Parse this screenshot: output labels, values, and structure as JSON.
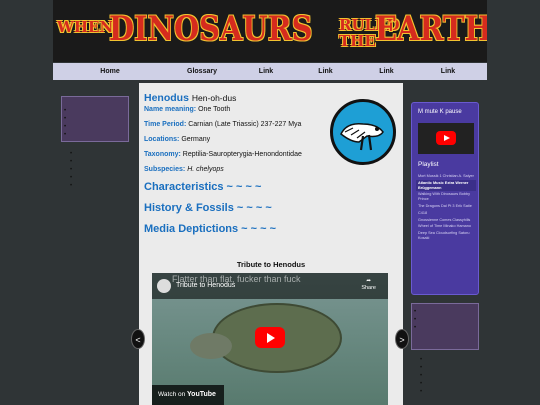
{
  "banner": {
    "when": "WHEN",
    "dinosaurs": "DINOSAURS",
    "ruled": "RULED",
    "the": "THE",
    "earth": "EARTH"
  },
  "nav": [
    "Home",
    "Glossary",
    "Link",
    "Link",
    "Link",
    "Link"
  ],
  "species": {
    "name": "Henodus",
    "pronunciation": "Hen-oh-dus",
    "fields": [
      {
        "label": "Name meaning:",
        "value": "One Tooth"
      },
      {
        "label": "Time Period:",
        "value": "Carnian (Late Triassic) 237-227 Mya"
      },
      {
        "label": "Locations:",
        "value": "Germany"
      },
      {
        "label": "Taxonomy:",
        "value": "Reptilia-Sauropterygia-Henondontidae"
      },
      {
        "label": "Subspecies:",
        "value": "H. chelyops"
      }
    ]
  },
  "sections": [
    "Characteristics ~ ~ ~ ~",
    "History & Fossils ~ ~ ~ ~",
    "Media Deptictions ~ ~ ~ ~"
  ],
  "video": {
    "heading": "Tribute to Henodus",
    "title": "Tribute to Henodus",
    "overlay_text": "Flatter than flat, fucker than fuck",
    "share": "Share",
    "watch_on": "Watch on",
    "youtube": "YouTube"
  },
  "arrows": {
    "prev": "<",
    "next": ">"
  },
  "player": {
    "title": "M mute K pause",
    "playlist_label": "Playlist",
    "items": [
      "Mort Mussik 1 Christian A. Salyer",
      "Atlantic Music Extra Werner Brüggemann",
      "Walking With Dinosaurs Bobby Prince",
      "The Dragons Dal Pt 3 Erik Satie",
      "C418",
      "Gnossienne Comes Classyhills",
      "Wheel of Time Minako Hamano",
      "Deep Sea Cloudsurfing Satoru Kosaki"
    ],
    "active_index": 1
  },
  "colors": {
    "accent": "#1a6fbf",
    "nav_bg": "#cfd0e6",
    "player_bg": "#4a3aa0",
    "banner_red": "#d52b1e",
    "banner_yellow": "#f2c230"
  }
}
